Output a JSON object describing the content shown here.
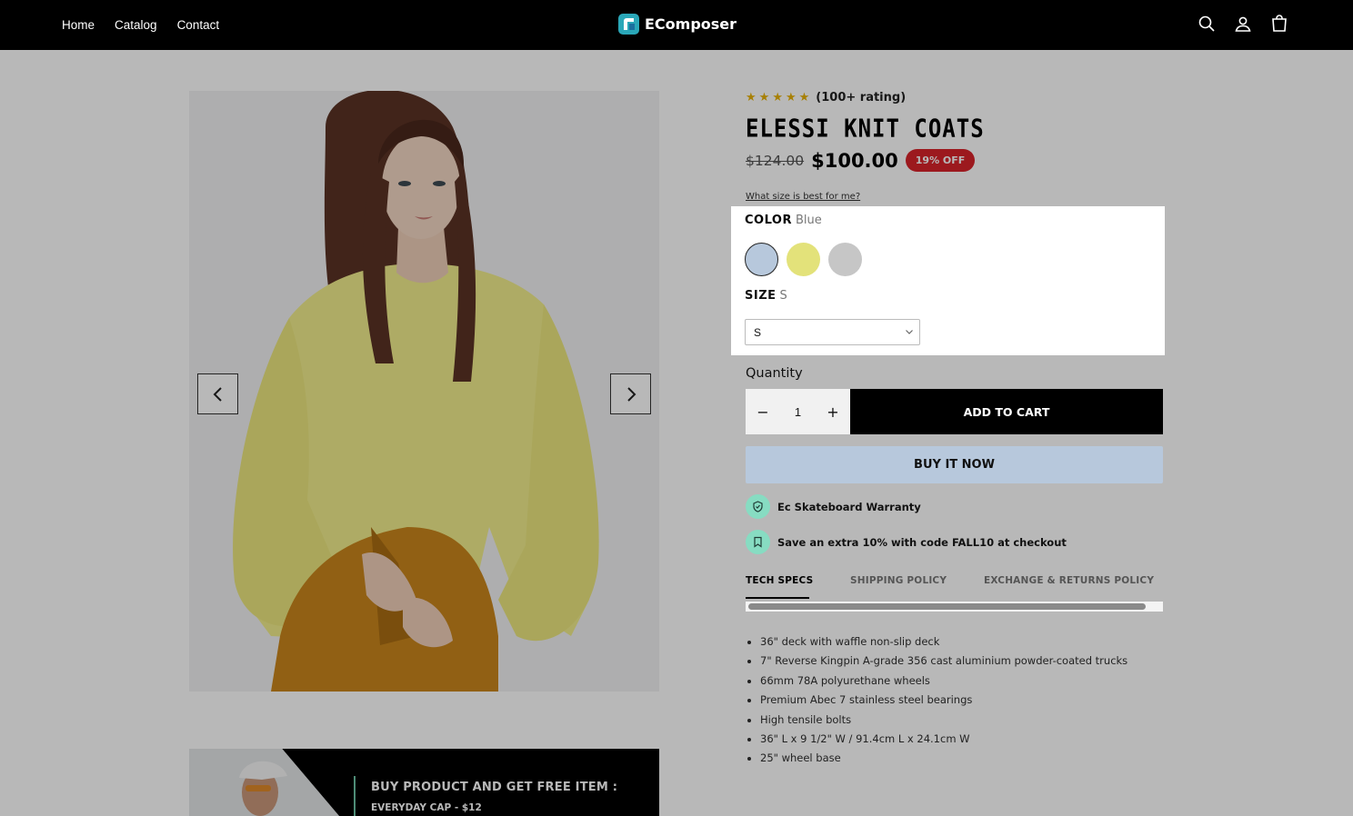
{
  "header": {
    "nav": [
      "Home",
      "Catalog",
      "Contact"
    ],
    "logo_text": "EComposer",
    "icons": [
      "search-icon",
      "account-icon",
      "cart-icon"
    ]
  },
  "gallery": {
    "prev_icon": "chevron-left-icon",
    "next_icon": "chevron-right-icon"
  },
  "promo": {
    "title": "BUY PRODUCT AND GET FREE ITEM :",
    "subtitle": "EVERYDAY CAP - $12"
  },
  "product": {
    "rating_stars": 5,
    "rating_text": "(100+ rating)",
    "title": "ELESSI KNIT COATS",
    "old_price": "$124.00",
    "new_price": "$100.00",
    "discount_badge": "19% OFF",
    "size_guide": "What size is best for me?",
    "color_label": "COLOR",
    "color_value": "Blue",
    "swatches": [
      {
        "name": "Blue",
        "hex": "#b7c8dc",
        "selected": true
      },
      {
        "name": "Yellow",
        "hex": "#e3e27a",
        "selected": false
      },
      {
        "name": "Grey",
        "hex": "#c6c6c6",
        "selected": false
      }
    ],
    "size_label": "SIZE",
    "size_value": "S",
    "size_select_value": "S",
    "quantity_label": "Quantity",
    "quantity": "1",
    "minus": "−",
    "plus": "+",
    "add_to_cart": "ADD TO CART",
    "buy_now": "BUY IT NOW",
    "perks": [
      {
        "icon": "shield-icon",
        "text": "Ec Skateboard Warranty"
      },
      {
        "icon": "bookmark-icon",
        "text": "Save an extra 10% with code FALL10 at checkout"
      }
    ],
    "tabs": [
      "TECH SPECS",
      "SHIPPING POLICY",
      "EXCHANGE & RETURNS POLICY"
    ],
    "specs": [
      "36\" deck with waffle non-slip deck",
      "7\" Reverse Kingpin A-grade 356 cast aluminium powder-coated trucks",
      "66mm 78A polyurethane wheels",
      "Premium Abec 7 stainless steel bearings",
      "High tensile bolts",
      "36\" L x 9 1/2\" W / 91.4cm L x 24.1cm W",
      "25\" wheel base"
    ]
  },
  "colors": {
    "header_bg": "#000000",
    "badge": "#d8232a",
    "star": "#e8b208",
    "perk_icon_bg": "#87dcc2",
    "buy_now_bg": "#b7c8dc",
    "sweater": "#f2ee8c",
    "pants": "#c9861c"
  }
}
